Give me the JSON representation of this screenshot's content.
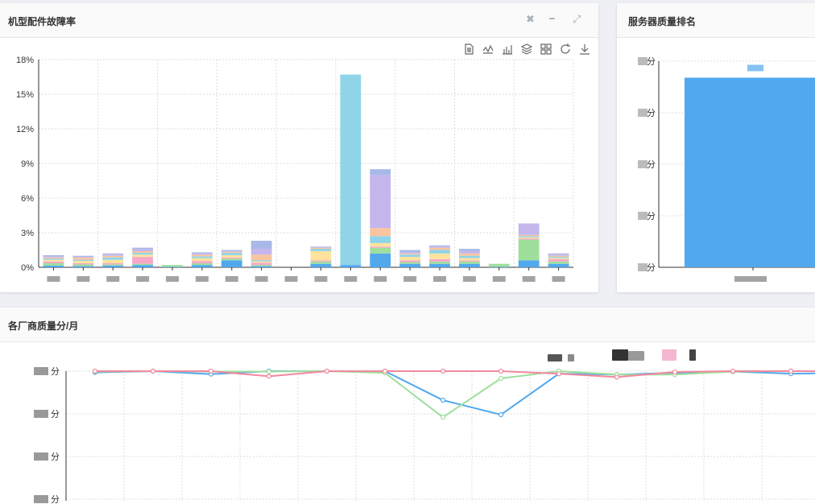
{
  "panels": {
    "failure": {
      "title": "机型配件故障率"
    },
    "server": {
      "title": "服务器质量排名"
    },
    "vendor": {
      "title": "各厂商质量分/月"
    }
  },
  "controls": {
    "close": "✖",
    "minimize": "━",
    "expand": "⤢"
  },
  "toolbar": [
    {
      "name": "data-view-icon"
    },
    {
      "name": "line-chart-icon"
    },
    {
      "name": "bar-chart-icon"
    },
    {
      "name": "stack-icon"
    },
    {
      "name": "tiled-icon"
    },
    {
      "name": "restore-icon"
    },
    {
      "name": "download-icon"
    }
  ],
  "colors": [
    "#52a8ec",
    "#9edf9c",
    "#f7a8c8",
    "#fde39d",
    "#8fd4e9",
    "#f9c4a0",
    "#c4b6ed",
    "#a8b9e8",
    "#5cb6b6",
    "#e99ec0"
  ],
  "chart_data": [
    {
      "type": "bar",
      "stacked": true,
      "ylim": [
        0,
        18
      ],
      "yticks": [
        "0%",
        "3%",
        "6%",
        "9%",
        "12%",
        "15%",
        "18%"
      ],
      "grid": true,
      "stacks": [
        [
          0.15,
          0.2,
          0.15,
          0.15,
          0.1,
          0.1,
          0.1,
          0.1
        ],
        [
          0.1,
          0.15,
          0.1,
          0.2,
          0.1,
          0.2,
          0.05,
          0.1
        ],
        [
          0.15,
          0.1,
          0.1,
          0.3,
          0.2,
          0.15,
          0.1,
          0.1
        ],
        [
          0.2,
          0.1,
          0.6,
          0.2,
          0.15,
          0.15,
          0.2,
          0.1
        ],
        [
          0.05,
          0.15,
          0,
          0,
          0,
          0,
          0,
          0
        ],
        [
          0.2,
          0.15,
          0.2,
          0.25,
          0.15,
          0.15,
          0.1,
          0.1
        ],
        [
          0.6,
          0.15,
          0.1,
          0.2,
          0.2,
          0.1,
          0.05,
          0.1
        ],
        [
          0.1,
          0.1,
          0.2,
          0.1,
          0.1,
          0.5,
          0.5,
          0.7
        ],
        [
          0,
          0,
          0,
          0,
          0,
          0,
          0,
          0
        ],
        [
          0.3,
          0.2,
          0.1,
          0.8,
          0.2,
          0.1,
          0.05,
          0.05
        ],
        [
          0.2,
          0,
          0,
          0,
          16.5,
          0,
          0,
          0
        ],
        [
          1.2,
          0.5,
          0.1,
          0.3,
          0.6,
          0.7,
          4.6,
          0.5
        ],
        [
          0.3,
          0.15,
          0.15,
          0.3,
          0.2,
          0.1,
          0.1,
          0.2
        ],
        [
          0.3,
          0.2,
          0.2,
          0.5,
          0.3,
          0.2,
          0.1,
          0.1
        ],
        [
          0.3,
          0.2,
          0.1,
          0.2,
          0.2,
          0.2,
          0.2,
          0.2
        ],
        [
          0.05,
          0.25,
          0,
          0,
          0,
          0,
          0,
          0
        ],
        [
          0.6,
          1.8,
          0.1,
          0.1,
          0.1,
          0.1,
          1.0,
          0
        ],
        [
          0.3,
          0.2,
          0.2,
          0.1,
          0.1,
          0.1,
          0.1,
          0.1
        ]
      ]
    },
    {
      "type": "bar",
      "values": [
        92
      ],
      "ylim": [
        0,
        100
      ],
      "yticks": [
        "分",
        "分",
        "分",
        "分",
        "分"
      ]
    },
    {
      "type": "line",
      "ylim": [
        0,
        3
      ],
      "yticks": [
        "分",
        "分",
        "分",
        "分"
      ],
      "grid": true,
      "series": [
        {
          "color": "#52a8ec",
          "values": [
            2.97,
            3.0,
            2.93,
            3.0,
            3.0,
            3.0,
            2.32,
            1.98,
            2.94,
            2.92,
            2.96,
            2.99,
            2.94,
            2.96
          ]
        },
        {
          "color": "#9edf9c",
          "values": [
            2.99,
            3.0,
            2.99,
            2.99,
            3.0,
            2.96,
            1.92,
            2.83,
            3.0,
            2.92,
            2.92,
            2.99,
            3.0,
            3.0
          ]
        },
        {
          "color": "#f2889e",
          "values": [
            3.0,
            3.0,
            3.0,
            2.88,
            3.0,
            3.0,
            3.0,
            3.0,
            2.94,
            2.86,
            2.98,
            3.0,
            3.0,
            3.0
          ]
        }
      ]
    }
  ]
}
